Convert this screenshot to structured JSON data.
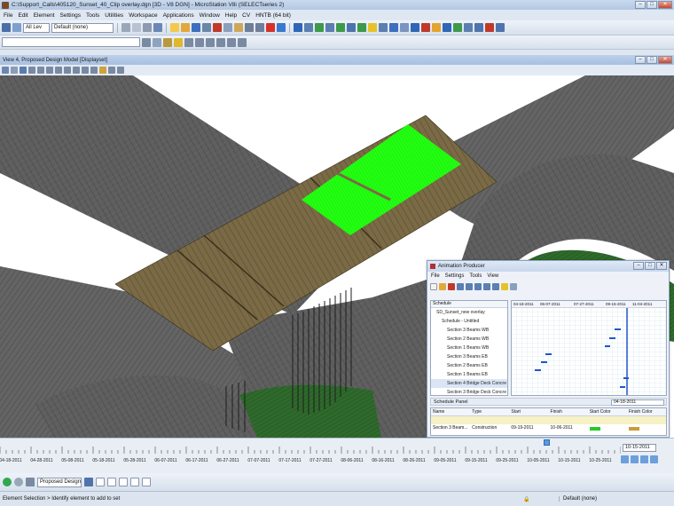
{
  "app": {
    "title": "C:\\Support_Calls\\405120_Sunset_40_Clip overlay.dgn [3D - V8 DGN] - MicroStation V8i (SELECTseries 2)",
    "menus": [
      "File",
      "Edit",
      "Element",
      "Settings",
      "Tools",
      "Utilities",
      "Workspace",
      "Applications",
      "Window",
      "Help",
      "CV",
      "HNTB (64 bit)"
    ]
  },
  "toolbar": {
    "level_select": "All Lev",
    "style_select": "Default (none)"
  },
  "view": {
    "title": "View 4, Proposed Design Model [Displayset]"
  },
  "animation_producer": {
    "title": "Animation Producer",
    "menus": [
      "File",
      "Settings",
      "Tools",
      "View"
    ],
    "tree_header": "Schedule",
    "tree": [
      {
        "label": "SD_Sunset_new overlay",
        "level": 1
      },
      {
        "label": "Schedule - Untitled",
        "level": 2
      },
      {
        "label": "Section 3 Beams WB",
        "level": 3
      },
      {
        "label": "Section 2 Beams WB",
        "level": 3
      },
      {
        "label": "Section 1 Beams WB",
        "level": 3
      },
      {
        "label": "Section 3 Beams EB",
        "level": 3
      },
      {
        "label": "Section 2 Beams EB",
        "level": 3
      },
      {
        "label": "Section 1 Beams EB",
        "level": 3
      },
      {
        "label": "Section 4 Bridge Deck Concre",
        "level": 3,
        "selected": true
      },
      {
        "label": "Section 3 Bridge Deck Concre",
        "level": 3
      }
    ],
    "gantt_dates": [
      "04-18-2011",
      "06-07-2011",
      "07-27-2011",
      "09-15-2011",
      "11-04-2011"
    ],
    "schedule_panel": {
      "title": "Schedule Panel",
      "date": "04-18-2011",
      "columns": [
        "Name",
        "Type",
        "Start",
        "Finish",
        "Start Color",
        "Finish Color"
      ],
      "rows": [
        [
          "",
          "",
          "",
          "",
          "",
          ""
        ],
        [
          "Section 3 Beam...",
          "Construction",
          "09-19-2011",
          "10-06-2011",
          "",
          ""
        ]
      ]
    }
  },
  "timeline": {
    "labels": [
      "04-18-2011",
      "04-28-2011",
      "05-08-2011",
      "05-18-2011",
      "05-28-2011",
      "06-07-2011",
      "06-17-2011",
      "06-27-2011",
      "07-07-2011",
      "07-17-2011",
      "07-27-2011",
      "08-06-2011",
      "08-16-2011",
      "08-26-2011",
      "09-05-2011",
      "09-15-2011",
      "09-25-2011",
      "10-05-2011",
      "10-15-2011",
      "10-25-2011"
    ],
    "current_date": "10-15-2011"
  },
  "bottom_toolbar": {
    "model_select": "Proposed Design M"
  },
  "status": {
    "message": "Element Selection > Identify element to add to set",
    "level": "Default (none)"
  },
  "colors": {
    "deck_highlight": "#22ff11",
    "deck_wood": "#7a6a45",
    "road_gray": "#5e5e5e",
    "grass_green": "#2f6a2c",
    "gantt_bar": "#2255cc"
  }
}
